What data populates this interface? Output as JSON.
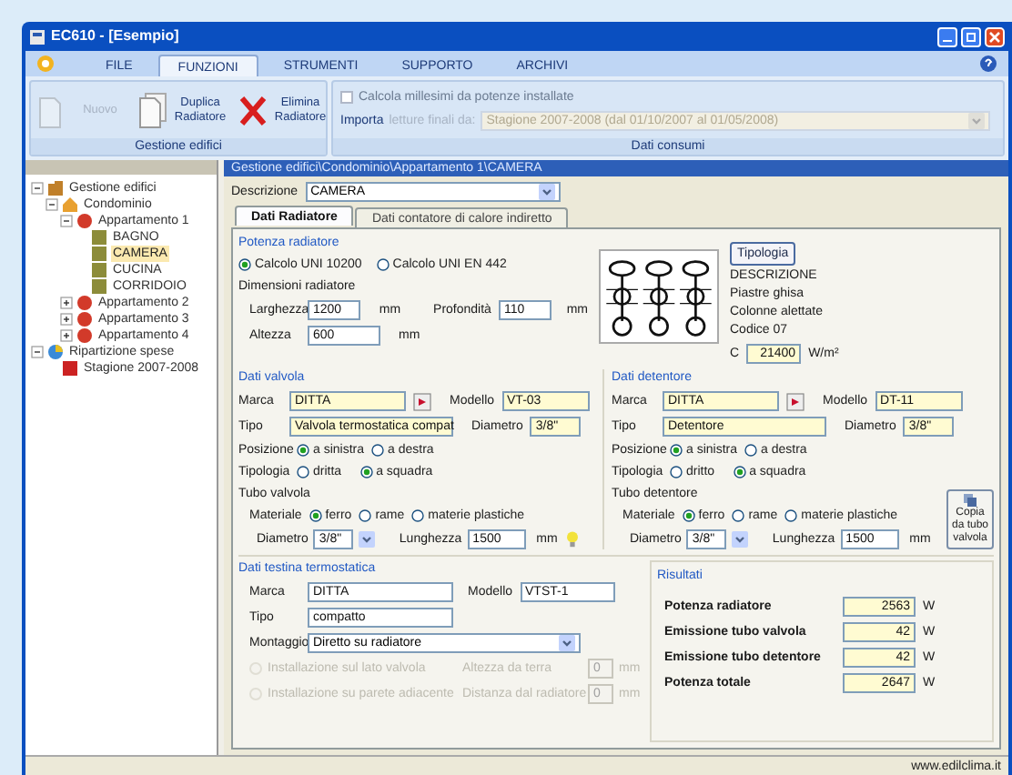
{
  "window": {
    "title": "EC610 - [Esempio]"
  },
  "menu": [
    {
      "label": "FILE",
      "selected": false
    },
    {
      "label": "FUNZIONI",
      "selected": true
    },
    {
      "label": "STRUMENTI",
      "selected": false
    },
    {
      "label": "SUPPORTO",
      "selected": false
    },
    {
      "label": "ARCHIVI",
      "selected": false
    }
  ],
  "ribbon": {
    "group": {
      "title": "Gestione edifici",
      "buttons": [
        {
          "label": "Nuovo",
          "kind": "page",
          "disabled": true
        },
        {
          "label": "Duplica Radiatore",
          "kind": "pages",
          "disabled": false
        },
        {
          "label": "Elimina Radiatore",
          "kind": "delete",
          "disabled": false
        }
      ]
    },
    "consumi": {
      "title": "Dati consumi",
      "checkbox": {
        "label": "Calcola millesimi da potenze installate",
        "checked": false
      },
      "import_label": "Importa",
      "import_hint": "letture finali da:",
      "season": "Stagione 2007-2008 (dal 01/10/2007 al 01/05/2008)"
    }
  },
  "tree": [
    {
      "label": "Gestione edifici",
      "kind": "building",
      "selected": false,
      "expanded": true,
      "children": [
        {
          "label": "Condominio",
          "kind": "house",
          "selected": false,
          "expanded": true,
          "children": [
            {
              "label": "Appartamento 1",
              "kind": "apartment",
              "selected": false,
              "expanded": true,
              "children": [
                {
                  "label": "BAGNO",
                  "kind": "room",
                  "selected": false
                },
                {
                  "label": "CAMERA",
                  "kind": "room",
                  "selected": true
                },
                {
                  "label": "CUCINA",
                  "kind": "room",
                  "selected": false
                },
                {
                  "label": "CORRIDOIO",
                  "kind": "room",
                  "selected": false
                }
              ]
            },
            {
              "label": "Appartamento 2",
              "kind": "apartment",
              "selected": false,
              "expanded": false
            },
            {
              "label": "Appartamento 3",
              "kind": "apartment",
              "selected": false,
              "expanded": false
            },
            {
              "label": "Appartamento 4",
              "kind": "apartment",
              "selected": false,
              "expanded": false
            }
          ]
        }
      ]
    },
    {
      "label": "Ripartizione spese",
      "kind": "sharing",
      "selected": false,
      "expanded": true,
      "children": [
        {
          "label": "Stagione 2007-2008",
          "kind": "season",
          "selected": false
        }
      ]
    }
  ],
  "breadcrumb": "Gestione edifici\\Condominio\\Appartamento 1\\CAMERA",
  "descrizione": {
    "label": "Descrizione",
    "value": "CAMERA"
  },
  "tabs": [
    {
      "label": "Dati Radiatore",
      "selected": true
    },
    {
      "label": "Dati contatore di calore indiretto",
      "selected": false
    }
  ],
  "potenza": {
    "title": "Potenza radiatore",
    "methods": [
      {
        "label": "Calcolo UNI 10200",
        "selected": true
      },
      {
        "label": "Calcolo UNI EN 442",
        "selected": false
      }
    ],
    "dims_title": "Dimensioni radiatore",
    "fields": [
      {
        "label": "Larghezza",
        "value": "1200",
        "unit": "mm"
      },
      {
        "label": "Profondità",
        "value": "110",
        "unit": "mm"
      },
      {
        "label": "Altezza",
        "value": "600",
        "unit": "mm"
      }
    ]
  },
  "tipologia": {
    "button": "Tipologia",
    "description": [
      "DESCRIZIONE",
      "Piastre ghisa",
      "Colonne alettate",
      "Codice 07"
    ],
    "c_label": "C",
    "c_value": "21400",
    "c_unit": "W/m²"
  },
  "components": [
    {
      "kind": "valvola",
      "title": "Dati valvola",
      "marca": {
        "label": "Marca",
        "value": "DITTA"
      },
      "modello": {
        "label": "Modello",
        "value": "VT-03"
      },
      "tipo": {
        "label": "Tipo",
        "value": "Valvola termostatica compat"
      },
      "diametro": {
        "label": "Diametro",
        "value": "3/8\""
      },
      "posizione": {
        "label": "Posizione",
        "options": [
          {
            "label": "a sinistra",
            "selected": true
          },
          {
            "label": "a destra",
            "selected": false
          }
        ]
      },
      "tipologia": {
        "label": "Tipologia",
        "options": [
          {
            "label": "dritta",
            "selected": false
          },
          {
            "label": "a squadra",
            "selected": true
          }
        ]
      },
      "tubo": {
        "title": "Tubo valvola",
        "materiale": {
          "label": "Materiale",
          "options": [
            {
              "label": "ferro",
              "selected": true
            },
            {
              "label": "rame",
              "selected": false
            },
            {
              "label": "materie plastiche",
              "selected": false
            }
          ]
        },
        "diametro": {
          "label": "Diametro",
          "value": "3/8\""
        },
        "lunghezza": {
          "label": "Lunghezza",
          "value": "1500",
          "unit": "mm"
        }
      }
    },
    {
      "kind": "detentore",
      "title": "Dati detentore",
      "marca": {
        "label": "Marca",
        "value": "DITTA"
      },
      "modello": {
        "label": "Modello",
        "value": "DT-11"
      },
      "tipo": {
        "label": "Tipo",
        "value": "Detentore"
      },
      "diametro": {
        "label": "Diametro",
        "value": "3/8\""
      },
      "posizione": {
        "label": "Posizione",
        "options": [
          {
            "label": "a sinistra",
            "selected": true
          },
          {
            "label": "a destra",
            "selected": false
          }
        ]
      },
      "tipologia": {
        "label": "Tipologia",
        "options": [
          {
            "label": "dritto",
            "selected": false
          },
          {
            "label": "a squadra",
            "selected": true
          }
        ]
      },
      "tubo": {
        "title": "Tubo detentore",
        "materiale": {
          "label": "Materiale",
          "options": [
            {
              "label": "ferro",
              "selected": true
            },
            {
              "label": "rame",
              "selected": false
            },
            {
              "label": "materie plastiche",
              "selected": false
            }
          ]
        },
        "diametro": {
          "label": "Diametro",
          "value": "3/8\""
        },
        "lunghezza": {
          "label": "Lunghezza",
          "value": "1500",
          "unit": "mm"
        }
      },
      "copy_button": "Copia da tubo valvola"
    }
  ],
  "testina": {
    "title": "Dati testina termostatica",
    "marca": {
      "label": "Marca",
      "value": "DITTA"
    },
    "modello": {
      "label": "Modello",
      "value": "VTST-1"
    },
    "tipo": {
      "label": "Tipo",
      "value": "compatto"
    },
    "montaggio": {
      "label": "Montaggio",
      "value": "Diretto su radiatore"
    },
    "options": [
      {
        "label": "Installazione sul lato valvola",
        "checked": false,
        "disabled": true
      },
      {
        "label": "Installazione su parete adiacente",
        "checked": false,
        "disabled": true
      }
    ],
    "distances": [
      {
        "label": "Altezza da terra",
        "value": "0",
        "unit": "mm",
        "disabled": true
      },
      {
        "label": "Distanza dal radiatore",
        "value": "0",
        "unit": "mm",
        "disabled": true
      }
    ]
  },
  "risultati": {
    "title": "Risultati",
    "rows": [
      {
        "label": "Potenza radiatore",
        "value": "2563",
        "unit": "W"
      },
      {
        "label": "Emissione tubo valvola",
        "value": "42",
        "unit": "W"
      },
      {
        "label": "Emissione tubo detentore",
        "value": "42",
        "unit": "W"
      },
      {
        "label": "Potenza totale",
        "value": "2647",
        "unit": "W"
      }
    ]
  },
  "status_bar": "www.edilclima.it"
}
